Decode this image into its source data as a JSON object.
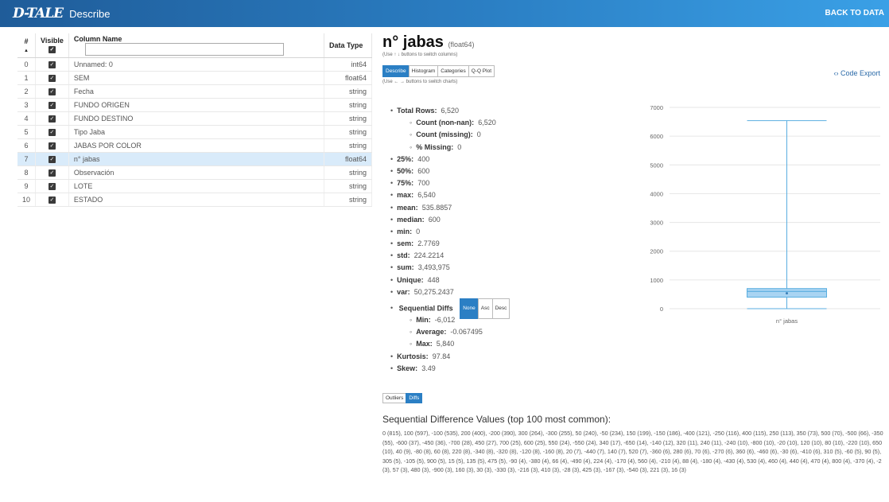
{
  "header": {
    "brand": "D-TALE",
    "title": "Describe",
    "back_label": "BACK TO DATA"
  },
  "columns_table": {
    "headers": {
      "index": "#",
      "sort_arrow": "▲",
      "visible": "Visible",
      "name": "Column Name",
      "dtype": "Data Type"
    },
    "search_value": "",
    "rows": [
      {
        "index": "0",
        "name": "Unnamed: 0",
        "dtype": "int64"
      },
      {
        "index": "1",
        "name": "SEM",
        "dtype": "float64"
      },
      {
        "index": "2",
        "name": "Fecha",
        "dtype": "string"
      },
      {
        "index": "3",
        "name": "FUNDO ORIGEN",
        "dtype": "string"
      },
      {
        "index": "4",
        "name": "FUNDO DESTINO",
        "dtype": "string"
      },
      {
        "index": "5",
        "name": "Tipo Jaba",
        "dtype": "string"
      },
      {
        "index": "6",
        "name": "JABAS POR COLOR",
        "dtype": "string"
      },
      {
        "index": "7",
        "name": "n° jabas",
        "dtype": "float64",
        "selected": true
      },
      {
        "index": "8",
        "name": "Observación",
        "dtype": "string"
      },
      {
        "index": "9",
        "name": "LOTE",
        "dtype": "string"
      },
      {
        "index": "10",
        "name": "ESTADO",
        "dtype": "string"
      }
    ]
  },
  "detail": {
    "column_name": "n° jabas",
    "column_dtype": "(float64)",
    "column_hint": "(Use ↑ ↓ buttons to switch columns)",
    "tabs": [
      "Describe",
      "Histogram",
      "Categories",
      "Q-Q Plot"
    ],
    "active_tab": "Describe",
    "chart_hint": "(Use ← → buttons to switch charts)",
    "code_export": "‹› Code Export",
    "stats": [
      {
        "label": "Total Rows:",
        "value": "6,520",
        "level": 1
      },
      {
        "label": "Count (non-nan):",
        "value": "6,520",
        "level": 2
      },
      {
        "label": "Count (missing):",
        "value": "0",
        "level": 2
      },
      {
        "label": "% Missing:",
        "value": "0",
        "level": 2
      },
      {
        "label": "25%:",
        "value": "400",
        "level": 1
      },
      {
        "label": "50%:",
        "value": "600",
        "level": 1
      },
      {
        "label": "75%:",
        "value": "700",
        "level": 1
      },
      {
        "label": "max:",
        "value": "6,540",
        "level": 1
      },
      {
        "label": "mean:",
        "value": "535.8857",
        "level": 1
      },
      {
        "label": "median:",
        "value": "600",
        "level": 1
      },
      {
        "label": "min:",
        "value": "0",
        "level": 1
      },
      {
        "label": "sem:",
        "value": "2.7769",
        "level": 1
      },
      {
        "label": "std:",
        "value": "224.2214",
        "level": 1
      },
      {
        "label": "sum:",
        "value": "3,493,975",
        "level": 1
      },
      {
        "label": "Unique:",
        "value": "448",
        "level": 1
      },
      {
        "label": "var:",
        "value": "50,275.2437",
        "level": 1
      }
    ],
    "seq_diffs": {
      "label": "Sequential Diffs",
      "sort_buttons": [
        "None",
        "Asc",
        "Desc"
      ],
      "stats": [
        {
          "label": "Min:",
          "value": "-6,012"
        },
        {
          "label": "Average:",
          "value": "-0.067495"
        },
        {
          "label": "Max:",
          "value": "5,840"
        }
      ]
    },
    "stats_tail": [
      {
        "label": "Kurtosis:",
        "value": "97.84"
      },
      {
        "label": "Skew:",
        "value": "3.49"
      }
    ],
    "toggle_buttons": [
      "Outliers",
      "Diffs"
    ],
    "seq_title": "Sequential Difference Values (top 100 most common):",
    "seq_values": "0 (815), 100 (597), -100 (535), 200 (400), -200 (390), 300 (264), -300 (255), 50 (240), -50 (234), 150 (199), -150 (186), -400 (121), -250 (116), 400 (115), 250 (113), 350 (73), 500 (70), -500 (66), -350 (55), -600 (37), -450 (36), -700 (28), 450 (27), 700 (25), 600 (25), 550 (24), -550 (24), 340 (17), -650 (14), -140 (12), 320 (11), 240 (11), -240 (10), -800 (10), -20 (10), 120 (10), 80 (10), -220 (10), 650 (10), 40 (9), -80 (8), 60 (8), 220 (8), -340 (8), -320 (8), -120 (8), -160 (8), 20 (7), -440 (7), 140 (7), 520 (7), -360 (6), 280 (6), 70 (6), -270 (6), 360 (6), -460 (6), -30 (6), -410 (6), 310 (5), -60 (5), 90 (5), 305 (5), -105 (5), 900 (5), 15 (5), 135 (5), 475 (5), -90 (4), -380 (4), 66 (4), -490 (4), 224 (4), -170 (4), 560 (4), -210 (4), 88 (4), -180 (4), -430 (4), 530 (4), 460 (4), 440 (4), 470 (4), 800 (4), -370 (4), -2 (3), 57 (3), 480 (3), -900 (3), 160 (3), 30 (3), -330 (3), -216 (3), 410 (3), -28 (3), 425 (3), -167 (3), -540 (3), 221 (3), 16 (3)"
  },
  "chart_data": {
    "type": "box",
    "categories": [
      "n° jabas"
    ],
    "box": {
      "min": 0,
      "q1": 400,
      "median": 600,
      "q3": 700,
      "max": 6540,
      "mean": 535.8857
    },
    "ylim": [
      0,
      7000
    ],
    "yticks": [
      "0",
      "1000",
      "2000",
      "3000",
      "4000",
      "5000",
      "6000",
      "7000"
    ],
    "grid": true,
    "color": "#5aaee0"
  }
}
